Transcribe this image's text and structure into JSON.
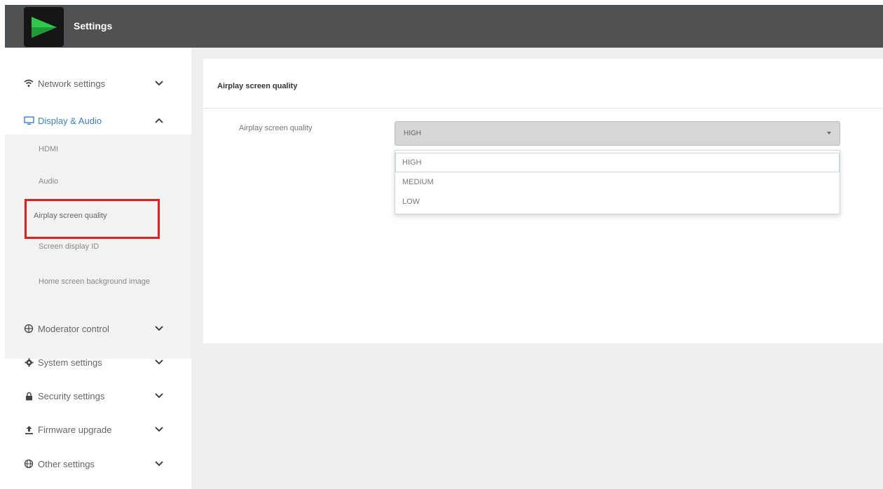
{
  "header": {
    "title": "Settings"
  },
  "sidebar": {
    "items": [
      {
        "label": "Network settings",
        "icon": "wifi-icon",
        "expanded": false
      },
      {
        "label": "Display & Audio",
        "icon": "monitor-icon",
        "expanded": true
      },
      {
        "label": "Moderator control",
        "icon": "network-icon",
        "expanded": false
      },
      {
        "label": "System settings",
        "icon": "gear-icon",
        "expanded": false
      },
      {
        "label": "Security settings",
        "icon": "lock-icon",
        "expanded": false
      },
      {
        "label": "Firmware upgrade",
        "icon": "upload-icon",
        "expanded": false
      },
      {
        "label": "Other settings",
        "icon": "globe-icon",
        "expanded": false
      }
    ],
    "submenu": [
      {
        "label": "HDMI"
      },
      {
        "label": "Audio"
      },
      {
        "label": "Airplay screen quality"
      },
      {
        "label": "Screen display ID"
      },
      {
        "label": "Home screen background image"
      }
    ]
  },
  "main": {
    "section_title": "Airplay screen quality",
    "field_label": "Airplay screen quality",
    "select": {
      "value": "HIGH",
      "options": [
        "HIGH",
        "MEDIUM",
        "LOW"
      ]
    }
  },
  "colors": {
    "header_bg": "#4f5153",
    "accent": "#3c7fc4",
    "highlight_border": "#e41d1d",
    "logo_green": "#2ec84a"
  }
}
